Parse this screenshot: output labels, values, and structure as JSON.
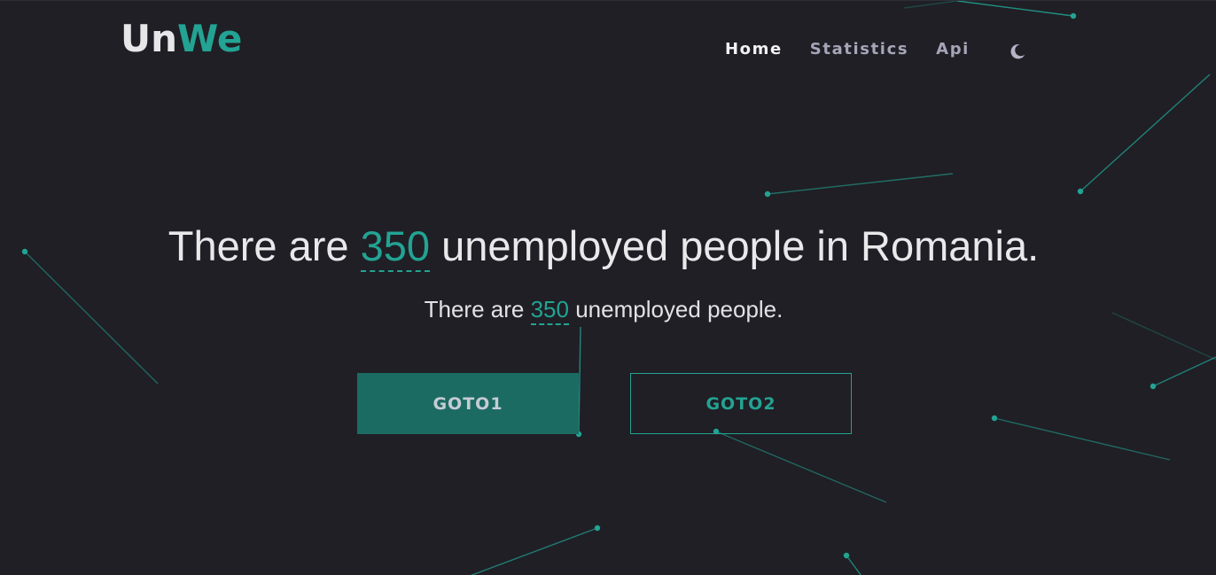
{
  "brand": {
    "part1": "Un",
    "part2": "We"
  },
  "nav": {
    "items": [
      {
        "label": "Home",
        "active": true
      },
      {
        "label": "Statistics",
        "active": false
      },
      {
        "label": "Api",
        "active": false
      }
    ],
    "theme_toggle_icon": "moon-icon"
  },
  "hero": {
    "headline_prefix": "There are ",
    "headline_number": "350",
    "headline_suffix": " unemployed people in Romania.",
    "subline_prefix": "There are ",
    "subline_number": "350",
    "subline_suffix": " unemployed people."
  },
  "buttons": {
    "primary_label": "GOTO1",
    "secondary_label": "GOTO2"
  },
  "colors": {
    "background": "#1f1f25",
    "accent": "#23a393",
    "primary_button": "#1b6b63",
    "text": "#e9e9ec",
    "nav_inactive": "#a6a5b8"
  }
}
